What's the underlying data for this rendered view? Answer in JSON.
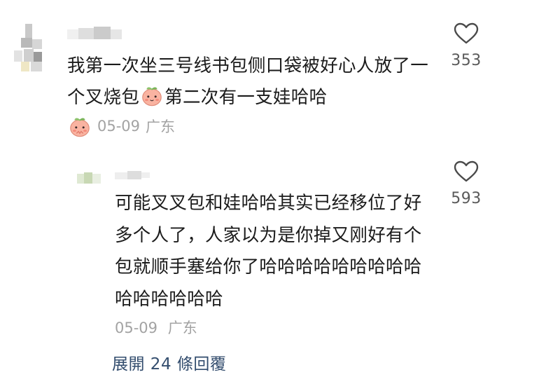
{
  "comment": {
    "text_parts": [
      "我第一次坐三号线书包侧口袋被好心人放了一个叉烧包",
      "第二次有一支娃哈哈"
    ],
    "inline_emoji": "peach-face-emoji",
    "meta_emoji": "peach-face-emoji",
    "date": "05-09",
    "location": "广东",
    "like_count": "353",
    "like_icon": "heart-outline-icon"
  },
  "reply": {
    "text": "可能叉叉包和娃哈哈其实已经移位了好多个人了，人家以为是你掉又刚好有个包就顺手塞给你了哈哈哈哈哈哈哈哈哈哈哈哈哈哈哈",
    "date": "05-09",
    "location": "广东",
    "like_count": "593",
    "like_icon": "heart-outline-icon"
  },
  "expand_replies_label": "展開 24 條回覆",
  "colors": {
    "text": "#1b1b1b",
    "meta": "#a3a3a3",
    "like_count": "#5a5a5a",
    "link": "#334d6e",
    "emoji_peach": "#f7a99a"
  }
}
